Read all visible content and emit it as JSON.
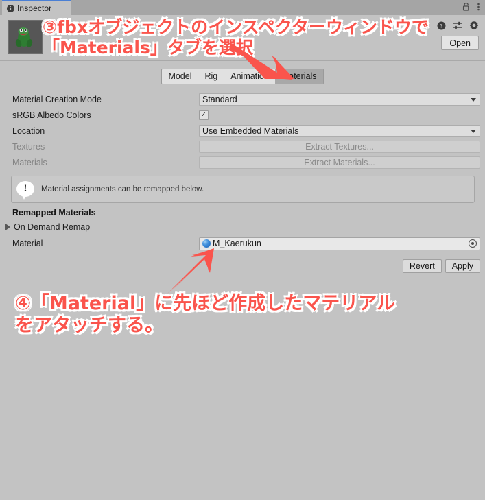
{
  "window": {
    "tab_label": "Inspector",
    "info_icon": "info-circle-icon",
    "lock_icon": "lock-icon",
    "menu_icon": "kebab-menu-icon"
  },
  "header": {
    "thumbnail_alt": "fbx-object-preview",
    "help_icon": "help-icon",
    "presets_icon": "preset-sliders-icon",
    "settings_icon": "gear-icon",
    "open_label": "Open"
  },
  "tabs": [
    {
      "label": "Model",
      "active": false
    },
    {
      "label": "Rig",
      "active": false
    },
    {
      "label": "Animation",
      "active": false
    },
    {
      "label": "Materials",
      "active": true
    }
  ],
  "properties": [
    {
      "label": "Material Creation Mode",
      "control": "dropdown",
      "value": "Standard",
      "disabled": false
    },
    {
      "label": "sRGB Albedo Colors",
      "control": "checkbox",
      "value": "✓",
      "checked": true,
      "disabled": false
    },
    {
      "label": "Location",
      "control": "dropdown",
      "value": "Use Embedded Materials",
      "disabled": false
    },
    {
      "label": "Textures",
      "control": "button",
      "value": "Extract Textures...",
      "disabled": true
    },
    {
      "label": "Materials",
      "control": "button",
      "value": "Extract Materials...",
      "disabled": true
    }
  ],
  "infobox": {
    "icon": "info-bubble-icon",
    "text": "Material assignments can be remapped below."
  },
  "remapped": {
    "section_title": "Remapped Materials",
    "foldout_label": "On Demand Remap",
    "foldout_icon": "triangle-right-icon",
    "material_label": "Material",
    "material_value": "M_Kaerukun",
    "material_icon": "material-sphere-icon",
    "picker_icon": "object-picker-icon"
  },
  "actions": {
    "revert_label": "Revert",
    "apply_label": "Apply"
  },
  "annotations": {
    "top": "③fbxオブジェクトのインスペクターウィンドウで\n「Materials」タブを選択",
    "bottom": "④「Material」に先ほど作成したマテリアル\nをアタッチする。",
    "color": "#fa544c",
    "arrow_top_name": "annotation-arrow-to-materials-tab",
    "arrow_bottom_name": "annotation-arrow-to-material-field"
  },
  "colors": {
    "window_bg": "#c3c3c3",
    "titlebar_bg": "#a5a5a5",
    "accent_tab": "#4a7fd4",
    "field_bg": "#dedede",
    "annotation_red": "#fa544c"
  }
}
